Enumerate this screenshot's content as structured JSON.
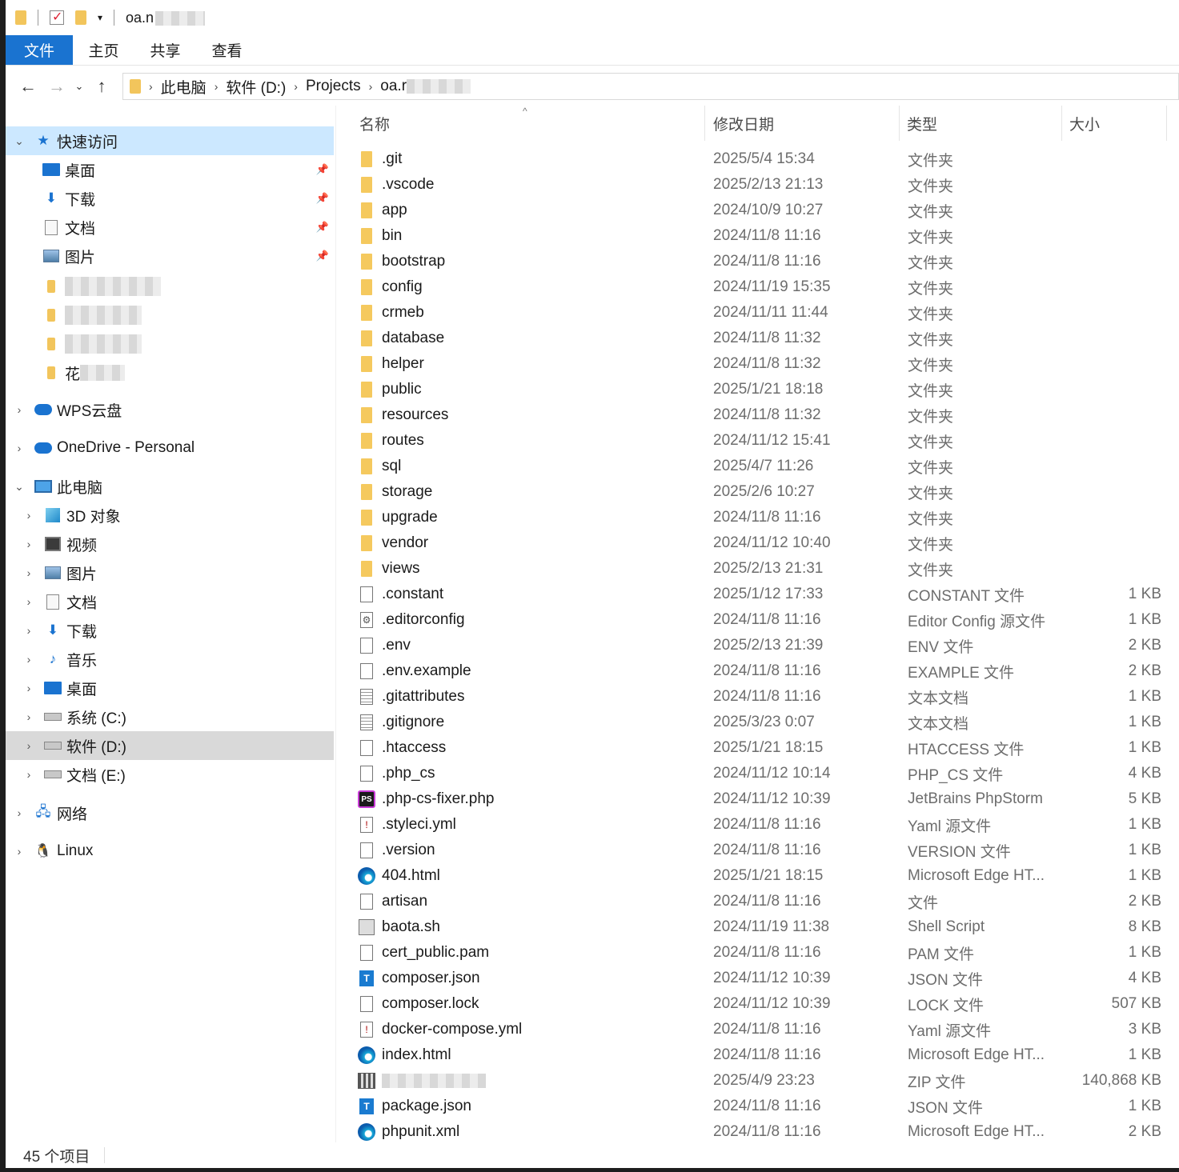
{
  "title_bar": {
    "path_visible": "oa.n"
  },
  "ribbon": {
    "tabs": [
      "文件",
      "主页",
      "共享",
      "查看"
    ]
  },
  "address": {
    "crumbs": [
      "此电脑",
      "软件 (D:)",
      "Projects",
      "oa.r"
    ]
  },
  "sidebar": {
    "quick_access": "快速访问",
    "quick_items": [
      "桌面",
      "下载",
      "文档",
      "图片"
    ],
    "blurred_first_char": "花",
    "wps": "WPS云盘",
    "onedrive": "OneDrive - Personal",
    "this_pc": "此电脑",
    "pc_items": [
      "3D 对象",
      "视频",
      "图片",
      "文档",
      "下载",
      "音乐",
      "桌面",
      "系统 (C:)",
      "软件 (D:)",
      "文档 (E:)"
    ],
    "network": "网络",
    "linux": "Linux"
  },
  "columns": {
    "name": "名称",
    "date": "修改日期",
    "type": "类型",
    "size": "大小"
  },
  "files": [
    {
      "name": ".git",
      "date": "2025/5/4 15:34",
      "type": "文件夹",
      "size": "",
      "icon": "folder"
    },
    {
      "name": ".vscode",
      "date": "2025/2/13 21:13",
      "type": "文件夹",
      "size": "",
      "icon": "folder"
    },
    {
      "name": "app",
      "date": "2024/10/9 10:27",
      "type": "文件夹",
      "size": "",
      "icon": "folder"
    },
    {
      "name": "bin",
      "date": "2024/11/8 11:16",
      "type": "文件夹",
      "size": "",
      "icon": "folder"
    },
    {
      "name": "bootstrap",
      "date": "2024/11/8 11:16",
      "type": "文件夹",
      "size": "",
      "icon": "folder"
    },
    {
      "name": "config",
      "date": "2024/11/19 15:35",
      "type": "文件夹",
      "size": "",
      "icon": "folder"
    },
    {
      "name": "crmeb",
      "date": "2024/11/11 11:44",
      "type": "文件夹",
      "size": "",
      "icon": "folder"
    },
    {
      "name": "database",
      "date": "2024/11/8 11:32",
      "type": "文件夹",
      "size": "",
      "icon": "folder"
    },
    {
      "name": "helper",
      "date": "2024/11/8 11:32",
      "type": "文件夹",
      "size": "",
      "icon": "folder"
    },
    {
      "name": "public",
      "date": "2025/1/21 18:18",
      "type": "文件夹",
      "size": "",
      "icon": "folder"
    },
    {
      "name": "resources",
      "date": "2024/11/8 11:32",
      "type": "文件夹",
      "size": "",
      "icon": "folder"
    },
    {
      "name": "routes",
      "date": "2024/11/12 15:41",
      "type": "文件夹",
      "size": "",
      "icon": "folder"
    },
    {
      "name": "sql",
      "date": "2025/4/7 11:26",
      "type": "文件夹",
      "size": "",
      "icon": "folder"
    },
    {
      "name": "storage",
      "date": "2025/2/6 10:27",
      "type": "文件夹",
      "size": "",
      "icon": "folder"
    },
    {
      "name": "upgrade",
      "date": "2024/11/8 11:16",
      "type": "文件夹",
      "size": "",
      "icon": "folder"
    },
    {
      "name": "vendor",
      "date": "2024/11/12 10:40",
      "type": "文件夹",
      "size": "",
      "icon": "folder"
    },
    {
      "name": "views",
      "date": "2025/2/13 21:31",
      "type": "文件夹",
      "size": "",
      "icon": "folder"
    },
    {
      "name": ".constant",
      "date": "2025/1/12 17:33",
      "type": "CONSTANT 文件",
      "size": "1 KB",
      "icon": "file"
    },
    {
      "name": ".editorconfig",
      "date": "2024/11/8 11:16",
      "type": "Editor Config 源文件",
      "size": "1 KB",
      "icon": "gear"
    },
    {
      "name": ".env",
      "date": "2025/2/13 21:39",
      "type": "ENV 文件",
      "size": "2 KB",
      "icon": "file"
    },
    {
      "name": ".env.example",
      "date": "2024/11/8 11:16",
      "type": "EXAMPLE 文件",
      "size": "2 KB",
      "icon": "file"
    },
    {
      "name": ".gitattributes",
      "date": "2024/11/8 11:16",
      "type": "文本文档",
      "size": "1 KB",
      "icon": "text"
    },
    {
      "name": ".gitignore",
      "date": "2025/3/23 0:07",
      "type": "文本文档",
      "size": "1 KB",
      "icon": "text"
    },
    {
      "name": ".htaccess",
      "date": "2025/1/21 18:15",
      "type": "HTACCESS 文件",
      "size": "1 KB",
      "icon": "file"
    },
    {
      "name": ".php_cs",
      "date": "2024/11/12 10:14",
      "type": "PHP_CS 文件",
      "size": "4 KB",
      "icon": "file"
    },
    {
      "name": ".php-cs-fixer.php",
      "date": "2024/11/12 10:39",
      "type": "JetBrains PhpStorm",
      "size": "5 KB",
      "icon": "ps"
    },
    {
      "name": ".styleci.yml",
      "date": "2024/11/8 11:16",
      "type": "Yaml 源文件",
      "size": "1 KB",
      "icon": "yml"
    },
    {
      "name": ".version",
      "date": "2024/11/8 11:16",
      "type": "VERSION 文件",
      "size": "1 KB",
      "icon": "file"
    },
    {
      "name": "404.html",
      "date": "2025/1/21 18:15",
      "type": "Microsoft Edge HT...",
      "size": "1 KB",
      "icon": "edge"
    },
    {
      "name": "artisan",
      "date": "2024/11/8 11:16",
      "type": "文件",
      "size": "2 KB",
      "icon": "file"
    },
    {
      "name": "baota.sh",
      "date": "2024/11/19 11:38",
      "type": "Shell Script",
      "size": "8 KB",
      "icon": "shell"
    },
    {
      "name": "cert_public.pam",
      "date": "2024/11/8 11:16",
      "type": "PAM 文件",
      "size": "1 KB",
      "icon": "file"
    },
    {
      "name": "composer.json",
      "date": "2024/11/12 10:39",
      "type": "JSON 文件",
      "size": "4 KB",
      "icon": "json"
    },
    {
      "name": "composer.lock",
      "date": "2024/11/12 10:39",
      "type": "LOCK 文件",
      "size": "507 KB",
      "icon": "file"
    },
    {
      "name": "docker-compose.yml",
      "date": "2024/11/8 11:16",
      "type": "Yaml 源文件",
      "size": "3 KB",
      "icon": "yml"
    },
    {
      "name": "index.html",
      "date": "2024/11/8 11:16",
      "type": "Microsoft Edge HT...",
      "size": "1 KB",
      "icon": "edge"
    },
    {
      "name": "",
      "date": "2025/4/9 23:23",
      "type": "ZIP 文件",
      "size": "140,868 KB",
      "icon": "zip"
    },
    {
      "name": "package.json",
      "date": "2024/11/8 11:16",
      "type": "JSON 文件",
      "size": "1 KB",
      "icon": "json"
    },
    {
      "name": "phpunit.xml",
      "date": "2024/11/8 11:16",
      "type": "Microsoft Edge HT...",
      "size": "2 KB",
      "icon": "edge"
    }
  ],
  "status": {
    "count": "45 个项目"
  }
}
